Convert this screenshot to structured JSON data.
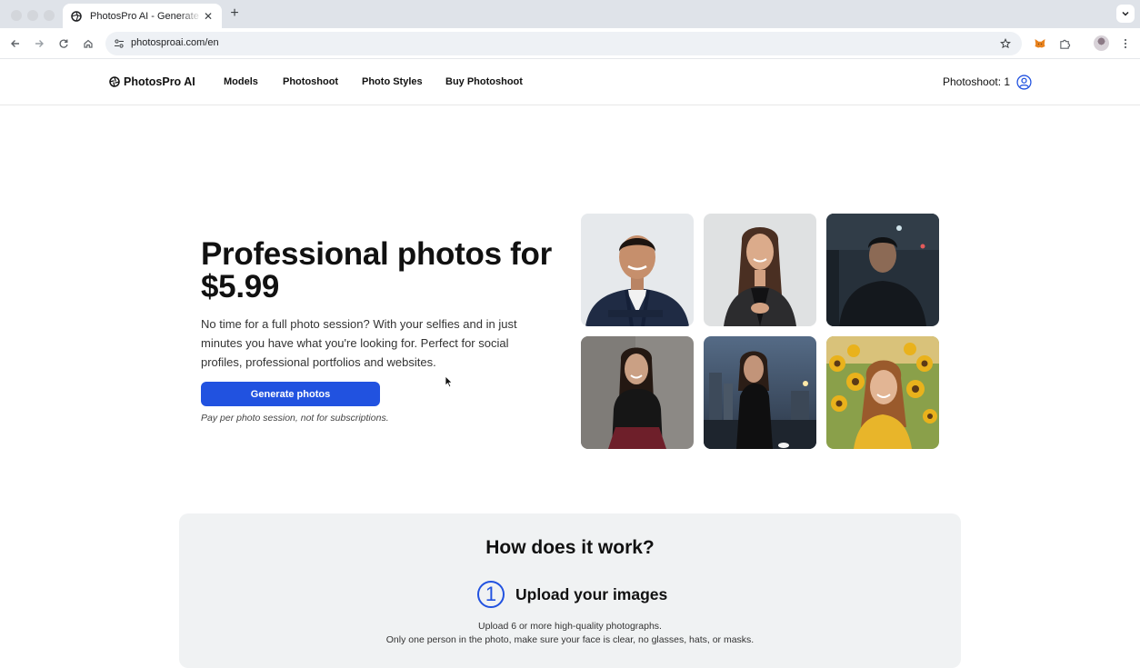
{
  "browser": {
    "tab_title": "PhotosPro AI - Generate professional photos",
    "tab_close_icon": "close-icon",
    "new_tab_icon": "plus-icon",
    "url": "photosproai.com/en"
  },
  "site": {
    "logo_text": "PhotosPro AI",
    "nav": [
      {
        "label": "Models"
      },
      {
        "label": "Photoshoot"
      },
      {
        "label": "Photo Styles"
      },
      {
        "label": "Buy Photoshoot"
      }
    ],
    "account_label": "Photoshoot: 1"
  },
  "hero": {
    "title": "Professional photos for $5.99",
    "description": "No time for a full photo session? With your selfies and in just minutes you have what you're looking for. Perfect for social profiles, professional portfolios and websites.",
    "cta_label": "Generate photos",
    "note": "Pay per photo session, not for subscriptions."
  },
  "how": {
    "title": "How does it work?",
    "step_number": "1",
    "step_title": "Upload your images",
    "step_desc_line1": "Upload 6 or more high-quality photographs.",
    "step_desc_line2": "Only one person in the photo, make sure your face is clear, no glasses, hats, or masks."
  },
  "colors": {
    "accent": "#2152e0",
    "section_bg": "#f0f2f3"
  }
}
